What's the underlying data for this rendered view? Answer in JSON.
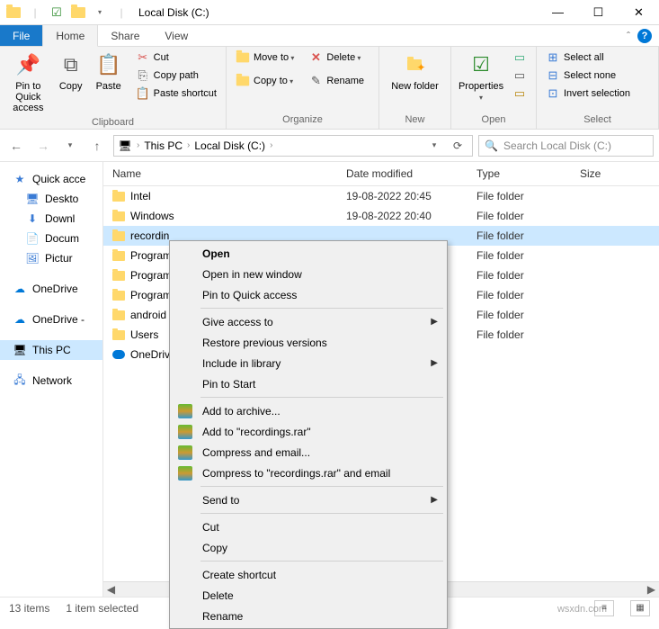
{
  "titlebar": {
    "title": "Local Disk (C:)",
    "dropdown_tip": "▾"
  },
  "tabs": {
    "file": "File",
    "home": "Home",
    "share": "Share",
    "view": "View"
  },
  "ribbon": {
    "clipboard": {
      "label": "Clipboard",
      "pin": "Pin to Quick access",
      "copy": "Copy",
      "paste": "Paste",
      "cut": "Cut",
      "copy_path": "Copy path",
      "paste_shortcut": "Paste shortcut"
    },
    "organize": {
      "label": "Organize",
      "move_to": "Move to",
      "copy_to": "Copy to",
      "delete": "Delete",
      "rename": "Rename"
    },
    "new": {
      "label": "New",
      "new_folder": "New folder"
    },
    "open": {
      "label": "Open",
      "properties": "Properties"
    },
    "select": {
      "label": "Select",
      "select_all": "Select all",
      "select_none": "Select none",
      "invert": "Invert selection"
    }
  },
  "address": {
    "this_pc": "This PC",
    "local_disk": "Local Disk (C:)"
  },
  "search": {
    "placeholder": "Search Local Disk (C:)"
  },
  "nav": {
    "quick_access": "Quick acce",
    "desktop": "Deskto",
    "downloads": "Downl",
    "documents": "Docum",
    "pictures": "Pictur",
    "onedrive": "OneDrive",
    "onedrive_personal": "OneDrive -",
    "this_pc": "This PC",
    "network": "Network"
  },
  "columns": {
    "name": "Name",
    "date": "Date modified",
    "type": "Type",
    "size": "Size"
  },
  "rows": [
    {
      "name": "Intel",
      "date": "19-08-2022 20:45",
      "type": "File folder",
      "selected": false,
      "icon": "folder"
    },
    {
      "name": "Windows",
      "date": "19-08-2022 20:40",
      "type": "File folder",
      "selected": false,
      "icon": "folder"
    },
    {
      "name": "recordin",
      "date": "",
      "type": "File folder",
      "selected": true,
      "icon": "folder"
    },
    {
      "name": "Program",
      "date": "",
      "type": "File folder",
      "selected": false,
      "icon": "folder"
    },
    {
      "name": "Program",
      "date": "",
      "type": "File folder",
      "selected": false,
      "icon": "folder"
    },
    {
      "name": "Program",
      "date": "",
      "type": "File folder",
      "selected": false,
      "icon": "folder"
    },
    {
      "name": "android",
      "date": "",
      "type": "File folder",
      "selected": false,
      "icon": "folder"
    },
    {
      "name": "Users",
      "date": "",
      "type": "File folder",
      "selected": false,
      "icon": "folder"
    },
    {
      "name": "OneDriv",
      "date": "",
      "type": "",
      "selected": false,
      "icon": "onedrive"
    }
  ],
  "context_menu": {
    "open": "Open",
    "open_new": "Open in new window",
    "pin_quick": "Pin to Quick access",
    "give_access": "Give access to",
    "restore": "Restore previous versions",
    "include_library": "Include in library",
    "pin_start": "Pin to Start",
    "add_archive": "Add to archive...",
    "add_rar": "Add to \"recordings.rar\"",
    "compress_email": "Compress and email...",
    "compress_rar_email": "Compress to \"recordings.rar\" and email",
    "send_to": "Send to",
    "cut": "Cut",
    "copy": "Copy",
    "create_shortcut": "Create shortcut",
    "delete": "Delete",
    "rename": "Rename"
  },
  "status": {
    "items": "13 items",
    "selected": "1 item selected"
  },
  "watermark": "wsxdn.com"
}
